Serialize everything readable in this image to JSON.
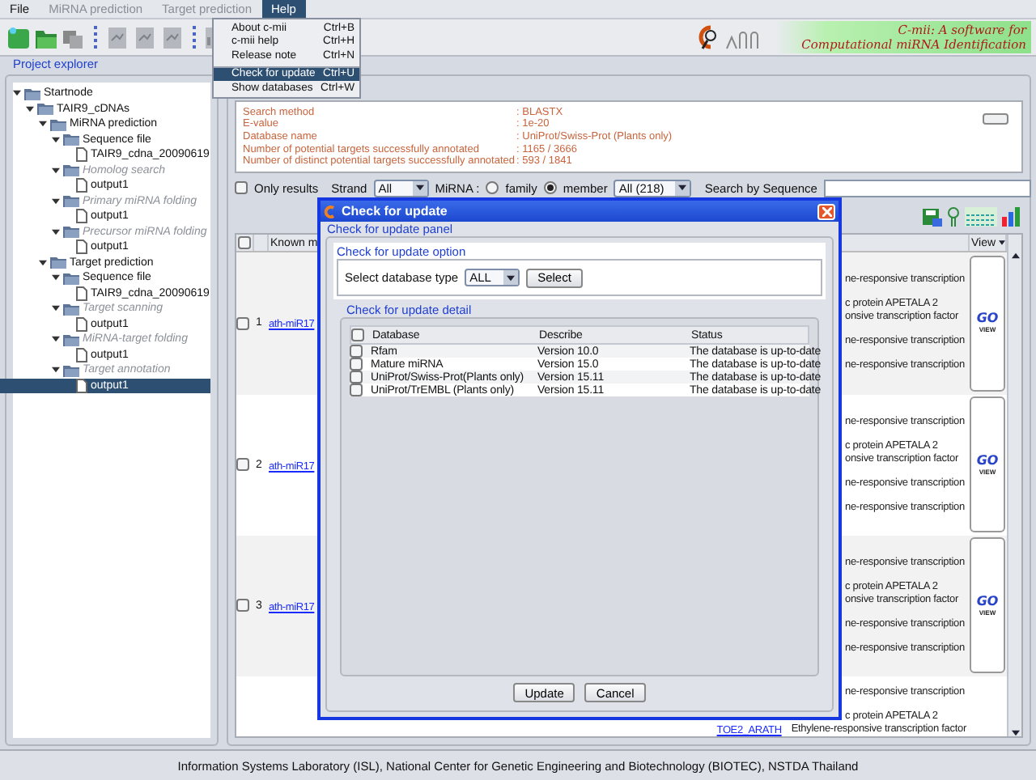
{
  "menubar": [
    {
      "label": "File",
      "disabled": false,
      "selected": false
    },
    {
      "label": "MiRNA prediction",
      "disabled": true,
      "selected": false
    },
    {
      "label": "Target prediction",
      "disabled": true,
      "selected": false
    },
    {
      "label": "Help",
      "disabled": false,
      "selected": true
    }
  ],
  "help_menu": [
    {
      "label": "About c-mii",
      "shortcut": "Ctrl+B",
      "selected": false,
      "separator_before": false
    },
    {
      "label": "c-mii help",
      "shortcut": "Ctrl+H",
      "selected": false,
      "separator_before": false
    },
    {
      "label": "Release note",
      "shortcut": "Ctrl+N",
      "selected": false,
      "separator_before": false
    },
    {
      "label": "Check for update",
      "shortcut": "Ctrl+U",
      "selected": true,
      "separator_before": true
    },
    {
      "label": "Show databases",
      "shortcut": "Ctrl+W",
      "selected": false,
      "separator_before": false
    }
  ],
  "logo": {
    "title": "C-mii: A software for",
    "subtitle": "Computational miRNA Identification"
  },
  "project_explorer": {
    "title": "Project explorer",
    "tree": [
      {
        "label": "Startnode",
        "kind": "folder",
        "expanded": true,
        "disabled": false,
        "selected": false,
        "children": [
          {
            "label": "TAIR9_cDNAs",
            "kind": "folder",
            "expanded": true,
            "disabled": false,
            "selected": false,
            "children": [
              {
                "label": "MiRNA prediction",
                "kind": "folder",
                "expanded": true,
                "disabled": false,
                "selected": false,
                "children": [
                  {
                    "label": "Sequence file",
                    "kind": "folder",
                    "expanded": true,
                    "disabled": false,
                    "selected": false,
                    "children": [
                      {
                        "label": "TAIR9_cdna_20090619",
                        "kind": "file",
                        "selected": false
                      }
                    ]
                  },
                  {
                    "label": "Homolog search",
                    "kind": "folder",
                    "expanded": true,
                    "disabled": true,
                    "selected": false,
                    "children": [
                      {
                        "label": "output1",
                        "kind": "file",
                        "selected": false
                      }
                    ]
                  },
                  {
                    "label": "Primary miRNA folding",
                    "kind": "folder",
                    "expanded": true,
                    "disabled": true,
                    "selected": false,
                    "children": [
                      {
                        "label": "output1",
                        "kind": "file",
                        "selected": false
                      }
                    ]
                  },
                  {
                    "label": "Precursor miRNA folding",
                    "kind": "folder",
                    "expanded": true,
                    "disabled": true,
                    "selected": false,
                    "children": [
                      {
                        "label": "output1",
                        "kind": "file",
                        "selected": false
                      }
                    ]
                  }
                ]
              },
              {
                "label": "Target prediction",
                "kind": "folder",
                "expanded": true,
                "disabled": false,
                "selected": false,
                "children": [
                  {
                    "label": "Sequence file",
                    "kind": "folder",
                    "expanded": true,
                    "disabled": false,
                    "selected": false,
                    "children": [
                      {
                        "label": "TAIR9_cdna_20090619",
                        "kind": "file",
                        "selected": false
                      }
                    ]
                  },
                  {
                    "label": "Target scanning",
                    "kind": "folder",
                    "expanded": true,
                    "disabled": true,
                    "selected": false,
                    "children": [
                      {
                        "label": "output1",
                        "kind": "file",
                        "selected": false
                      }
                    ]
                  },
                  {
                    "label": "MiRNA-target folding",
                    "kind": "folder",
                    "expanded": true,
                    "disabled": true,
                    "selected": false,
                    "children": [
                      {
                        "label": "output1",
                        "kind": "file",
                        "selected": false
                      }
                    ]
                  },
                  {
                    "label": "Target annotation",
                    "kind": "folder",
                    "expanded": true,
                    "disabled": true,
                    "selected": false,
                    "children": [
                      {
                        "label": "output1",
                        "kind": "file",
                        "selected": true
                      }
                    ]
                  }
                ]
              }
            ]
          }
        ]
      }
    ]
  },
  "summary": [
    {
      "label": "Search method",
      "value": ": BLASTX"
    },
    {
      "label": "E-value",
      "value": ": 1e-20"
    },
    {
      "label": "Database name",
      "value": ": UniProt/Swiss-Prot (Plants only)"
    },
    {
      "label": "Number of potential targets successfully annotated",
      "value": ": 1165 / 3666"
    },
    {
      "label": "Number of distinct potential targets successfully annotated",
      "value": ": 593 / 1841"
    }
  ],
  "filters": {
    "only_results": {
      "label": "Only results",
      "checked": false
    },
    "strand": {
      "label": "Strand",
      "value": "All"
    },
    "mirna": {
      "label": "MiRNA :",
      "options": [
        {
          "label": "family",
          "selected": false
        },
        {
          "label": "member",
          "selected": true
        }
      ],
      "value": "All (218)"
    },
    "search": {
      "label": "Search by Sequence"
    }
  },
  "table": {
    "select_all_checked": false,
    "columns": [
      "Known m",
      "View"
    ],
    "rows": [
      {
        "number": "1",
        "mirna": "ath-miR17",
        "checked": false,
        "lines": [
          "ne-responsive transcription",
          "c protein APETALA 2",
          "onsive transcription factor",
          "ne-responsive transcription",
          "ne-responsive transcription"
        ],
        "go": "GO",
        "view": "VIEW"
      },
      {
        "number": "2",
        "mirna": "ath-miR17",
        "checked": false,
        "lines": [
          "ne-responsive transcription",
          "c protein APETALA 2",
          "onsive transcription factor",
          "ne-responsive transcription",
          "ne-responsive transcription"
        ],
        "go": "GO",
        "view": "VIEW"
      },
      {
        "number": "3",
        "mirna": "ath-miR17",
        "checked": false,
        "lines": [
          "ne-responsive transcription",
          "c protein APETALA 2",
          "onsive transcription factor",
          "ne-responsive transcription",
          "ne-responsive transcription"
        ],
        "go": "GO",
        "view": "VIEW"
      }
    ],
    "last_row": {
      "lines": [
        "ne-responsive transcription",
        "c protein APETALA 2"
      ],
      "target": "TOE2_ARATH",
      "description": "Ethylene-responsive transcription factor"
    }
  },
  "dialog": {
    "title": "Check for update",
    "panel_title": "Check for update panel",
    "option": {
      "title": "Check for update option",
      "label": "Select database type",
      "value": "ALL",
      "button": "Select"
    },
    "detail": {
      "title": "Check for update detail",
      "select_all_checked": false,
      "columns": [
        "Database",
        "Describe",
        "Status"
      ],
      "rows": [
        {
          "database": "Rfam",
          "describe": "Version 10.0",
          "status": "The database is up-to-date",
          "checked": false
        },
        {
          "database": "Mature miRNA",
          "describe": "Version 15.0",
          "status": "The database is up-to-date",
          "checked": false
        },
        {
          "database": "UniProt/Swiss-Prot(Plants only)",
          "describe": "Version 15.11",
          "status": "The database is up-to-date",
          "checked": false
        },
        {
          "database": "UniProt/TrEMBL (Plants only)",
          "describe": "Version 15.11",
          "status": "The database is up-to-date",
          "checked": false
        }
      ]
    },
    "buttons": [
      "Update",
      "Cancel"
    ]
  },
  "status_bar": "Information Systems Laboratory (ISL), National Center for Genetic Engineering and Biotechnology (BIOTEC), NSTDA Thailand"
}
